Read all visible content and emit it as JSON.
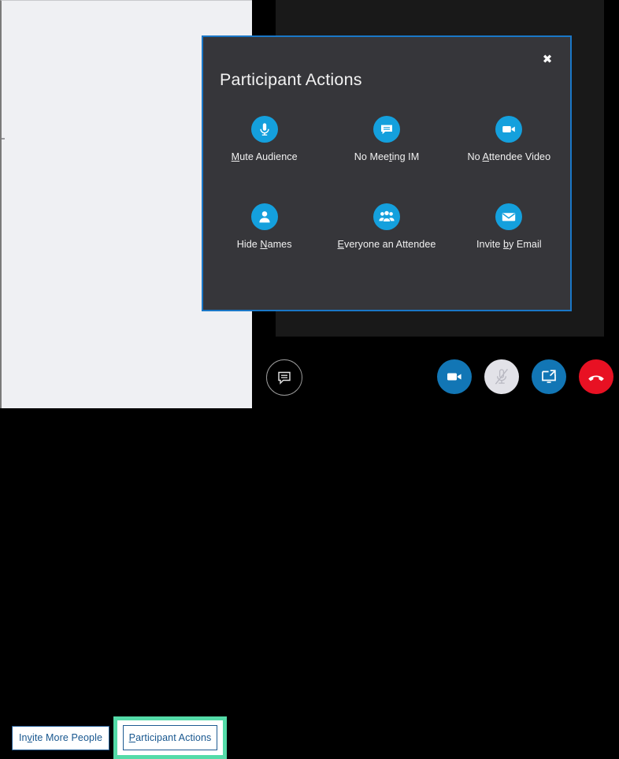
{
  "app": {
    "colors": {
      "accent_blue": "#14a0dd",
      "dialog_bg": "#36363a",
      "dialog_border": "#1a77c7",
      "pane_bg": "#eff0f3",
      "link_blue": "#18578f",
      "highlight_green": "#54dba8",
      "hangup_red": "#e81123",
      "control_blue": "#1276b5"
    }
  },
  "left_pane": {
    "buttons": [
      {
        "label": "Invite More People",
        "accesskey": "v",
        "highlighted": false
      },
      {
        "label": "Participant Actions",
        "accesskey": "P",
        "highlighted": true
      }
    ]
  },
  "dialog": {
    "title": "Participant Actions",
    "close_label": "✖",
    "close_icon": "close-icon",
    "actions": [
      {
        "label": "Mute Audience",
        "accesskey": "M",
        "icon": "microphone-icon"
      },
      {
        "label": "No Meeting IM",
        "accesskey": "t",
        "icon": "chat-bubble-icon"
      },
      {
        "label": "No Attendee Video",
        "accesskey": "A",
        "icon": "video-camera-icon"
      },
      {
        "label": "Hide Names",
        "accesskey": "N",
        "icon": "person-icon"
      },
      {
        "label": "Everyone an Attendee",
        "accesskey": "E",
        "icon": "people-group-icon"
      },
      {
        "label": "Invite by Email",
        "accesskey": "b",
        "icon": "envelope-icon"
      }
    ]
  },
  "call_bar": {
    "controls": [
      {
        "name": "instant-message-button",
        "icon": "chat-bubble-icon",
        "state": "idle"
      },
      {
        "name": "video-button",
        "icon": "video-camera-icon",
        "state": "on"
      },
      {
        "name": "microphone-button",
        "icon": "microphone-muted-icon",
        "state": "muted"
      },
      {
        "name": "present-screen-button",
        "icon": "present-screen-icon",
        "state": "on"
      },
      {
        "name": "hang-up-button",
        "icon": "hang-up-icon",
        "state": "active"
      }
    ]
  }
}
